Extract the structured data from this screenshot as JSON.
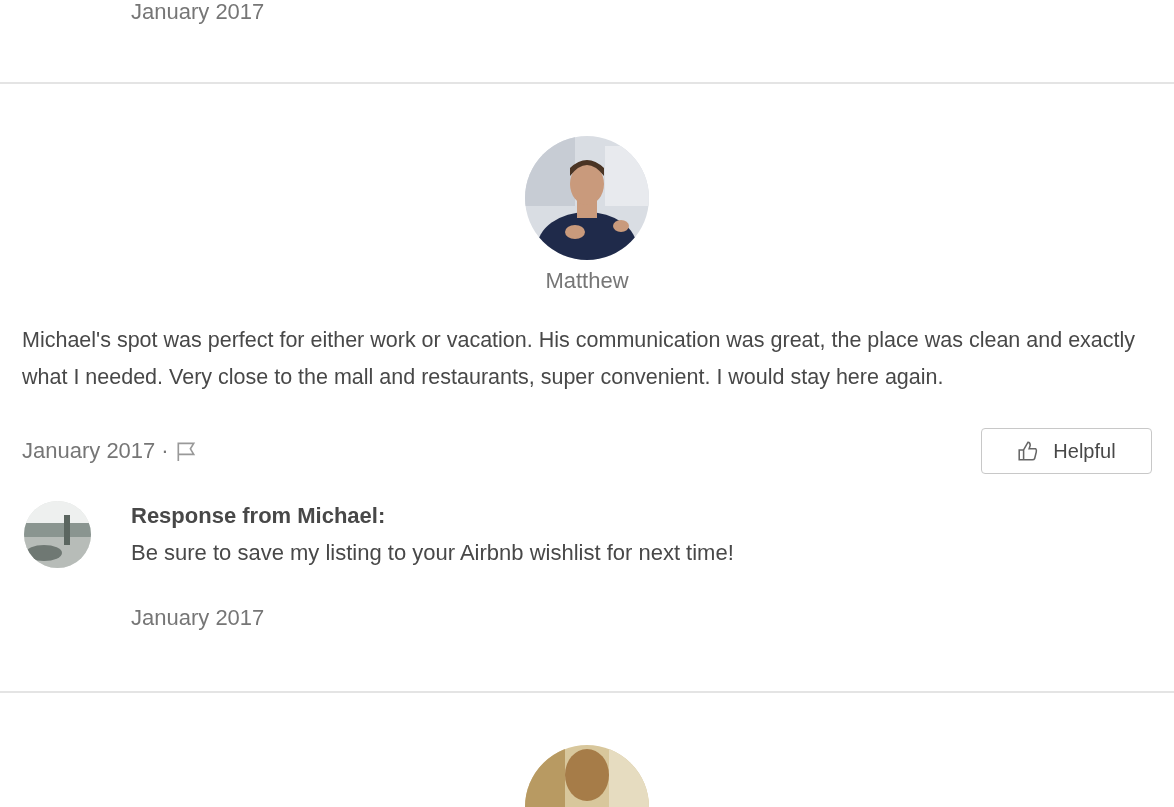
{
  "previous_review": {
    "date": "January 2017"
  },
  "review": {
    "author": "Matthew",
    "text": "Michael's spot was perfect for either work or vacation. His communication was great, the place was clean and exactly what I needed. Very close to the mall and restaurants, super convenient. I would stay here again.",
    "date": "January 2017",
    "separator": "·",
    "helpful_label": "Helpful",
    "response": {
      "title": "Response from Michael:",
      "text": "Be sure to save my listing to your Airbnb wishlist for next time!",
      "date": "January 2017"
    }
  }
}
